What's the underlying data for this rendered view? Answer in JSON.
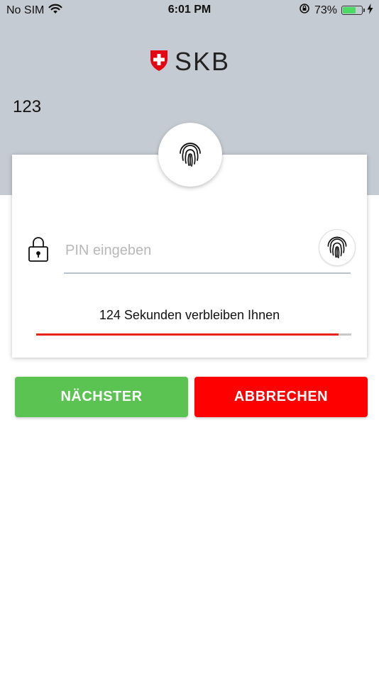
{
  "status_bar": {
    "carrier": "No SIM",
    "time": "6:01 PM",
    "battery_percent": "73%",
    "battery_level": 0.73,
    "icons": [
      "wifi-icon",
      "orientation-lock-icon",
      "battery-icon",
      "charging-icon"
    ]
  },
  "header": {
    "logo_text": "SKB",
    "account_number": "123"
  },
  "card": {
    "pin_placeholder": "PIN eingeben",
    "pin_value": "",
    "timer_text": "124 Sekunden verbleiben Ihnen",
    "timer_progress": 0.96
  },
  "actions": {
    "next_label": "NÄCHSTER",
    "cancel_label": "ABBRECHEN"
  },
  "colors": {
    "header_bg": "#c5cbd2",
    "next_button": "#5ac351",
    "cancel_button": "#fe0000",
    "progress_fill": "#e8231c",
    "logo_shield": "#e30613"
  }
}
